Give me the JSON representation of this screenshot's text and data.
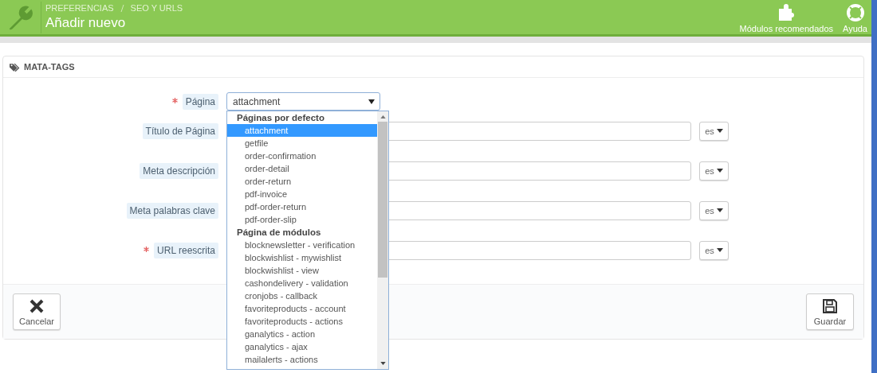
{
  "header": {
    "breadcrumb": [
      "PREFERENCIAS",
      "SEO Y URLS"
    ],
    "title": "Añadir nuevo",
    "toolbar": [
      {
        "kind": "puzzle",
        "label": "Módulos recomendados"
      },
      {
        "kind": "lifebuoy",
        "label": "Ayuda"
      }
    ]
  },
  "panel": {
    "title": "MATA-TAGS",
    "fields": [
      {
        "label": "Página",
        "required": true,
        "kind": "select",
        "value": "attachment"
      },
      {
        "label": "Título de Página",
        "required": false,
        "kind": "text",
        "language": "es"
      },
      {
        "label": "Meta descripción",
        "required": false,
        "kind": "text",
        "language": "es"
      },
      {
        "label": "Meta palabras clave",
        "required": false,
        "kind": "text",
        "language": "es"
      },
      {
        "label": "URL reescrita",
        "required": true,
        "kind": "text",
        "language": "es"
      }
    ],
    "dropdown": {
      "groups": [
        {
          "label": "Páginas por defecto",
          "options": [
            {
              "label": "attachment",
              "selected": true
            },
            {
              "label": "getfile",
              "selected": false
            },
            {
              "label": "order-confirmation",
              "selected": false
            },
            {
              "label": "order-detail",
              "selected": false
            },
            {
              "label": "order-return",
              "selected": false
            },
            {
              "label": "pdf-invoice",
              "selected": false
            },
            {
              "label": "pdf-order-return",
              "selected": false
            },
            {
              "label": "pdf-order-slip",
              "selected": false
            }
          ]
        },
        {
          "label": "Página de módulos",
          "options": [
            {
              "label": "blocknewsletter - verification",
              "selected": false
            },
            {
              "label": "blockwishlist - mywishlist",
              "selected": false
            },
            {
              "label": "blockwishlist - view",
              "selected": false
            },
            {
              "label": "cashondelivery - validation",
              "selected": false
            },
            {
              "label": "cronjobs - callback",
              "selected": false
            },
            {
              "label": "favoriteproducts - account",
              "selected": false
            },
            {
              "label": "favoriteproducts - actions",
              "selected": false
            },
            {
              "label": "ganalytics - action",
              "selected": false
            },
            {
              "label": "ganalytics - ajax",
              "selected": false
            },
            {
              "label": "mailalerts - actions",
              "selected": false
            }
          ]
        }
      ]
    },
    "footer": [
      {
        "kind": "cancel",
        "label": "Cancelar"
      },
      {
        "kind": "save",
        "label": "Guardar"
      }
    ]
  }
}
